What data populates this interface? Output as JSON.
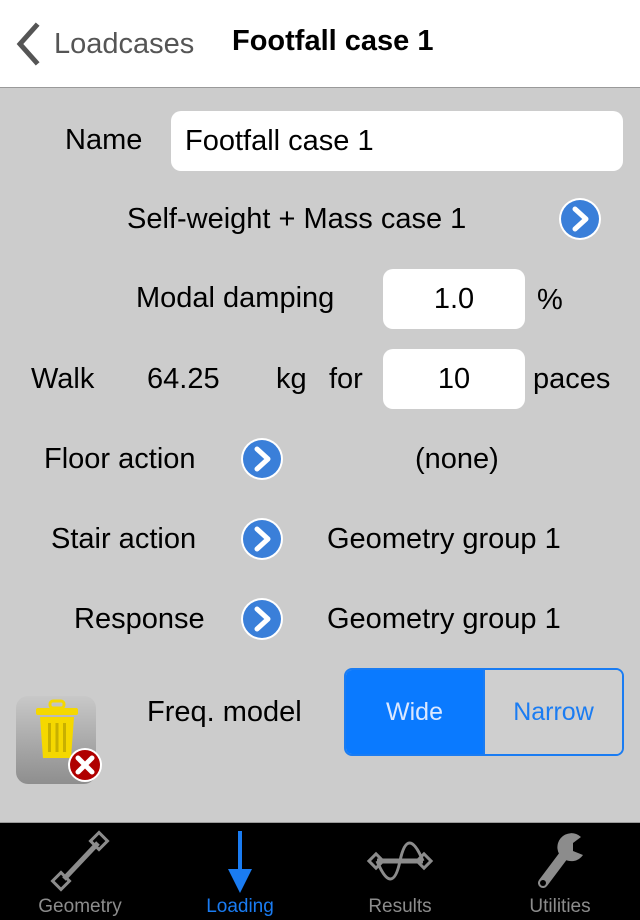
{
  "navbar": {
    "back_label": "Loadcases",
    "title": "Footfall case 1"
  },
  "form": {
    "name_label": "Name",
    "name_value": "Footfall case 1",
    "mass_case_label": "Self-weight + Mass case 1",
    "modal_damping_label": "Modal damping",
    "modal_damping_value": "1.0",
    "modal_damping_unit": "%",
    "walk_label": "Walk",
    "walk_mass": "64.25",
    "walk_mass_unit": "kg",
    "walk_for": "for",
    "paces_value": "10",
    "paces_unit": "paces",
    "floor_action_label": "Floor action",
    "floor_action_value": "(none)",
    "stair_action_label": "Stair action",
    "stair_action_value": "Geometry group 1",
    "response_label": "Response",
    "response_value": "Geometry group 1",
    "freq_model_label": "Freq. model",
    "freq_model_options": [
      "Wide",
      "Narrow"
    ],
    "freq_model_selected": "Wide"
  },
  "tabbar": {
    "tabs": [
      {
        "label": "Geometry",
        "icon": "geometry-icon"
      },
      {
        "label": "Loading",
        "icon": "loading-arrow-icon"
      },
      {
        "label": "Results",
        "icon": "results-wave-icon"
      },
      {
        "label": "Utilities",
        "icon": "wrench-icon"
      }
    ],
    "active": "Loading"
  },
  "colors": {
    "accent": "#1a7cf2",
    "disclosure_blue": "#3a7fd9",
    "background": "#cccccc",
    "trash_yellow": "#f5d800",
    "delete_red": "#b00000"
  }
}
